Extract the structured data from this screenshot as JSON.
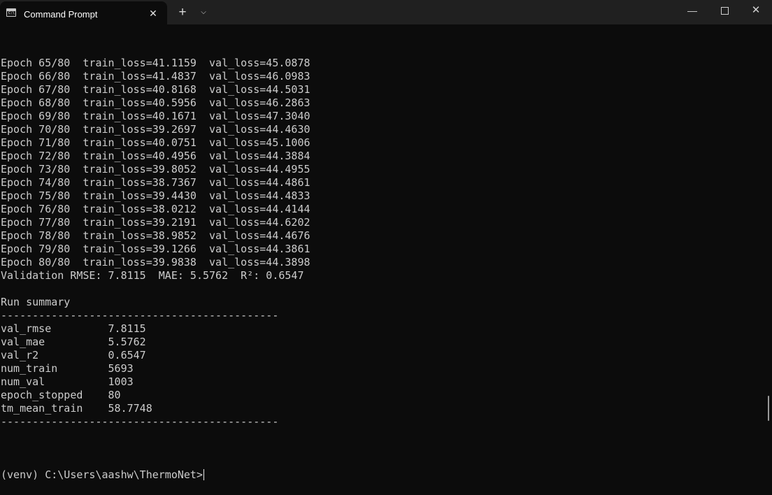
{
  "window": {
    "tab_title": "Command Prompt",
    "tab_icon_text": "C:\\.",
    "close_tab_glyph": "✕",
    "new_tab_glyph": "+",
    "dropdown_glyph": "⌵",
    "minimize_glyph": "—",
    "close_glyph": "✕"
  },
  "console": {
    "lines": [
      "Epoch 65/80  train_loss=41.1159  val_loss=45.0878",
      "Epoch 66/80  train_loss=41.4837  val_loss=46.0983",
      "Epoch 67/80  train_loss=40.8168  val_loss=44.5031",
      "Epoch 68/80  train_loss=40.5956  val_loss=46.2863",
      "Epoch 69/80  train_loss=40.1671  val_loss=47.3040",
      "Epoch 70/80  train_loss=39.2697  val_loss=44.4630",
      "Epoch 71/80  train_loss=40.0751  val_loss=45.1006",
      "Epoch 72/80  train_loss=40.4956  val_loss=44.3884",
      "Epoch 73/80  train_loss=39.8052  val_loss=44.4955",
      "Epoch 74/80  train_loss=38.7367  val_loss=44.4861",
      "Epoch 75/80  train_loss=39.4430  val_loss=44.4833",
      "Epoch 76/80  train_loss=38.0212  val_loss=44.4144",
      "Epoch 77/80  train_loss=39.2191  val_loss=44.6202",
      "Epoch 78/80  train_loss=38.9852  val_loss=44.4676",
      "Epoch 79/80  train_loss=39.1266  val_loss=44.3861",
      "Epoch 80/80  train_loss=39.9838  val_loss=44.3898",
      "Validation RMSE: 7.8115  MAE: 5.5762  R²: 0.6547",
      "",
      "Run summary",
      "--------------------------------------------",
      "val_rmse         7.8115",
      "val_mae          5.5762",
      "val_r2           0.6547",
      "num_train        5693",
      "num_val          1003",
      "epoch_stopped    80",
      "tm_mean_train    58.7748",
      "--------------------------------------------",
      ""
    ],
    "prompt": "(venv) C:\\Users\\aashw\\ThermoNet>"
  }
}
